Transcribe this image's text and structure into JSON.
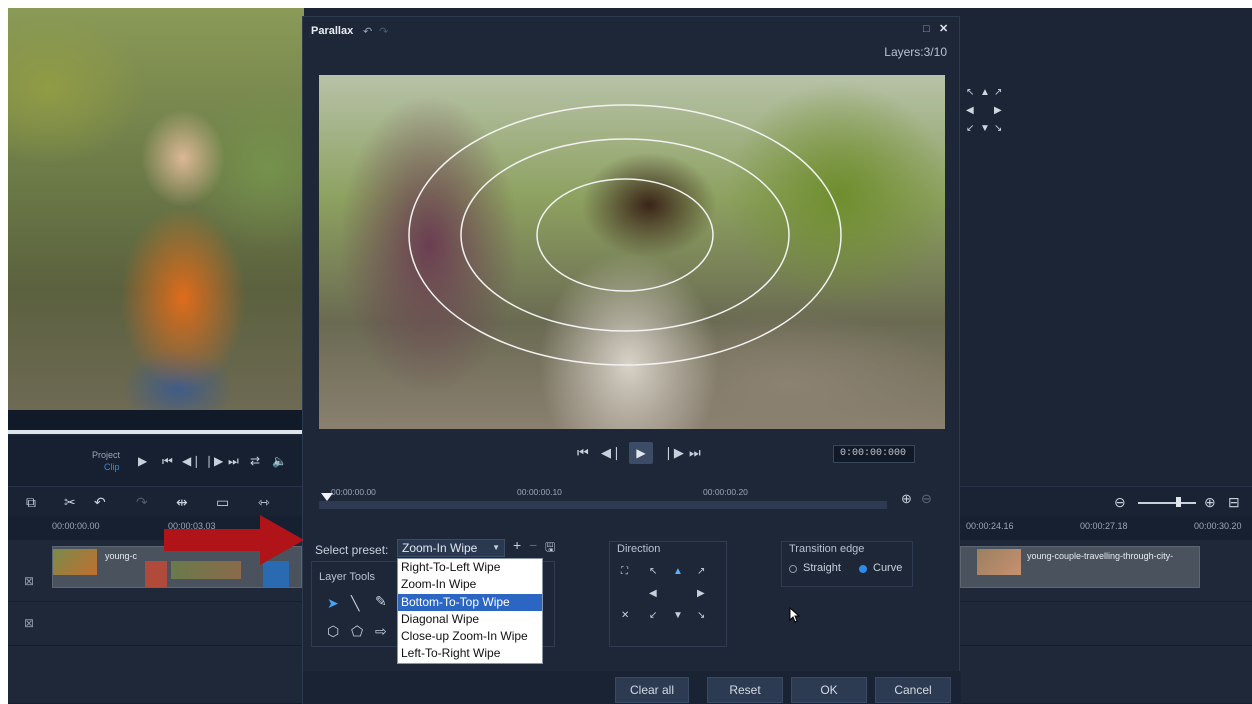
{
  "left_controls": {
    "project_label": "Project",
    "clip_label": "Clip"
  },
  "timeline": {
    "ruler_labels": [
      "00:00:00.00",
      "00:00:03.03",
      "00:00:24.16",
      "00:00:27.18",
      "00:00:30.20"
    ],
    "clips": [
      "young-c",
      "young-couple-travelling-through-city-"
    ]
  },
  "dialog": {
    "title": "Parallax",
    "layers": "Layers:3/10",
    "timecode": "0:00:00:000",
    "mini_timeline_labels": [
      "00:00:00.00",
      "00:00:00.10",
      "00:00:00.20"
    ],
    "preset_label": "Select preset:",
    "preset_value": "Zoom-In Wipe",
    "preset_options": [
      "Right-To-Left Wipe",
      "Zoom-In Wipe",
      "Bottom-To-Top Wipe",
      "Diagonal Wipe",
      "Close-up Zoom-In Wipe",
      "Left-To-Right Wipe"
    ],
    "layer_tools_label": "Layer Tools",
    "direction_label": "Direction",
    "transition_edge_label": "Transition edge",
    "straight_label": "Straight",
    "curve_label": "Curve",
    "buttons": {
      "clear_all": "Clear all",
      "reset": "Reset",
      "ok": "OK",
      "cancel": "Cancel"
    }
  },
  "colors": {
    "app_bg": "#1c2535",
    "accent_blue": "#2b66c3",
    "annotation_arrow": "#b01418"
  },
  "icons": {
    "annotation": "red-arrow-icon"
  }
}
